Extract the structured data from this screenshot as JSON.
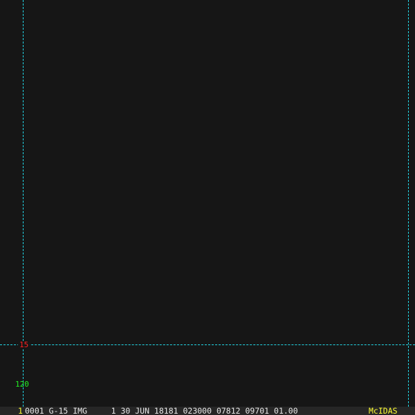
{
  "overlay": {
    "line_color": "#22d8e8",
    "latitude_label": {
      "text": "15",
      "color": "#ff2020"
    },
    "longitude_label": {
      "text": "120",
      "color": "#22ee22"
    }
  },
  "status_bar": {
    "frame_number": "1",
    "frame_color": "#ffff33",
    "info": "0001 G-15 IMG     1 30 JUN 18181 023000 07812 09701 01.00",
    "brand": "McIDAS",
    "brand_color": "#ffff33"
  }
}
